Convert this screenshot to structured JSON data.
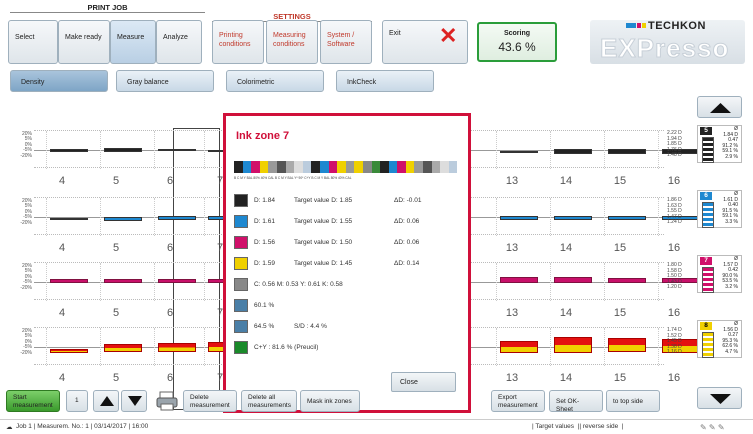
{
  "header": {
    "print_job": "PRINT JOB",
    "settings": "SETTINGS",
    "tabs": [
      "Select",
      "Make ready",
      "Measure",
      "Analyze"
    ],
    "settings_tabs": [
      "Printing conditions",
      "Measuring conditions",
      "System / Software"
    ],
    "exit": "Exit",
    "scoring_label": "Scoring",
    "scoring_value": "43.6 %",
    "brand": "TECHKON",
    "product": "EXPresso"
  },
  "subtabs": [
    "Density",
    "Gray balance",
    "Colorimetric",
    "InkCheck"
  ],
  "axis": [
    "20%",
    "5%",
    "0%",
    "-5%",
    "-20%"
  ],
  "zones_left": [
    "4",
    "5",
    "6",
    "7"
  ],
  "zones_right": [
    "13",
    "14",
    "15",
    "16"
  ],
  "right_panels": [
    {
      "id": "5",
      "color": "#222222",
      "labels": [
        "2.22 D",
        "1.94 D",
        "1.85 D",
        "1.76 D",
        "1.48 D"
      ],
      "values": [
        "Ø",
        "1.84 D",
        "0.47",
        "91.2 %",
        "59.1 %",
        "2.9 %"
      ]
    },
    {
      "id": "6",
      "color": "#1e88d0",
      "labels": [
        "1.86 D",
        "1.63 D",
        "1.55 D",
        "1.47 D",
        "1.24 D"
      ],
      "values": [
        "Ø",
        "1.61 D",
        "0.40",
        "91.5 %",
        "59.1 %",
        "3.3 %"
      ]
    },
    {
      "id": "7",
      "color": "#d0106a",
      "labels": [
        "1.80 D",
        "1.58 D",
        "1.50 D",
        "1.43 D",
        "1.20 D"
      ],
      "values": [
        "Ø",
        "1.57 D",
        "0.42",
        "90.0 %",
        "53.5 %",
        "3.2 %"
      ]
    },
    {
      "id": "8",
      "color": "#f0d000",
      "labels": [
        "1.74 D",
        "1.52 D",
        "1.45 D",
        "1.38 D",
        "1.16 D"
      ],
      "values": [
        "Ø",
        "1.56 D",
        "0.27",
        "95.3 %",
        "62.6 %",
        "4.7 %"
      ]
    }
  ],
  "popup": {
    "title": "Ink zone 7",
    "strip": "B C M Y BAL 80% 40% CAL B C M Y BAL Y* 90* C+Y B C M Y BAL 80% 40% CAL",
    "rows": [
      {
        "color": "#222222",
        "text": "D: 1.84",
        "target": "Target value D: 1.85",
        "delta": "ΔD: -0.01"
      },
      {
        "color": "#1e88d0",
        "text": "D: 1.61",
        "target": "Target value D: 1.55",
        "delta": "ΔD: 0.06"
      },
      {
        "color": "#d0106a",
        "text": "D: 1.56",
        "target": "Target value D: 1.50",
        "delta": "ΔD: 0.06"
      },
      {
        "color": "#f0d000",
        "text": "D: 1.59",
        "target": "Target value D: 1.45",
        "delta": "ΔD: 0.14"
      },
      {
        "color": "#888888",
        "text": "C: 0.56 M: 0.53 Y: 0.61 K: 0.58",
        "target": "",
        "delta": ""
      },
      {
        "color": "#4a7fa7",
        "text": "60.1 %",
        "target": "",
        "delta": ""
      },
      {
        "color": "#4a7fa7",
        "text": "64.5 %",
        "target": "S/D : 4.4 %",
        "delta": ""
      },
      {
        "color": "#1a8a2a",
        "text": "C+Y : 81.6 % (Preucil)",
        "target": "",
        "delta": ""
      }
    ],
    "close": "Close"
  },
  "bottom": {
    "start": "Start measurement",
    "counter": "1",
    "delete": "Delete measurement",
    "delete_all": "Delete all measurements",
    "mask": "Mask ink zones",
    "export": "Export measurement",
    "ok_sheet": "Set OK-Sheet",
    "top_side": "to top side"
  },
  "status": {
    "left": "Job 1 | Measurem. No.: 1 | 03/14/2017 | 16:00",
    "target": "Target values",
    "reverse": "reverse side"
  }
}
